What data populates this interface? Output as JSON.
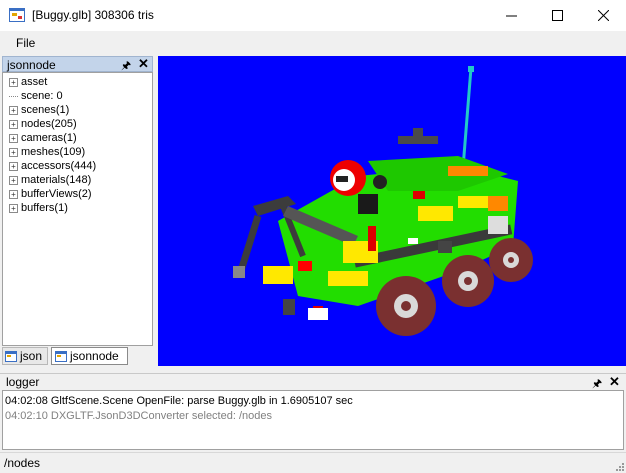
{
  "window": {
    "title": "[Buggy.glb] 308306 tris"
  },
  "menu": {
    "file": "File"
  },
  "tree_panel": {
    "title": "jsonnode",
    "items": [
      {
        "label": "asset",
        "expandable": true
      },
      {
        "label": "scene: 0",
        "expandable": false
      },
      {
        "label": "scenes(1)",
        "expandable": true
      },
      {
        "label": "nodes(205)",
        "expandable": true
      },
      {
        "label": "cameras(1)",
        "expandable": true
      },
      {
        "label": "meshes(109)",
        "expandable": true
      },
      {
        "label": "accessors(444)",
        "expandable": true
      },
      {
        "label": "materials(148)",
        "expandable": true
      },
      {
        "label": "bufferViews(2)",
        "expandable": true
      },
      {
        "label": "buffers(1)",
        "expandable": true
      }
    ],
    "tabs": [
      {
        "label": "json",
        "active": false
      },
      {
        "label": "jsonnode",
        "active": true
      }
    ]
  },
  "viewport": {
    "background": "#0000ff"
  },
  "logger": {
    "title": "logger",
    "lines": [
      "04:02:08 GltfScene.Scene OpenFile: parse Buggy.glb in 1.6905107 sec",
      "04:02:10 DXGLTF.JsonD3DConverter selected: /nodes"
    ]
  },
  "status": {
    "text": "/nodes"
  }
}
